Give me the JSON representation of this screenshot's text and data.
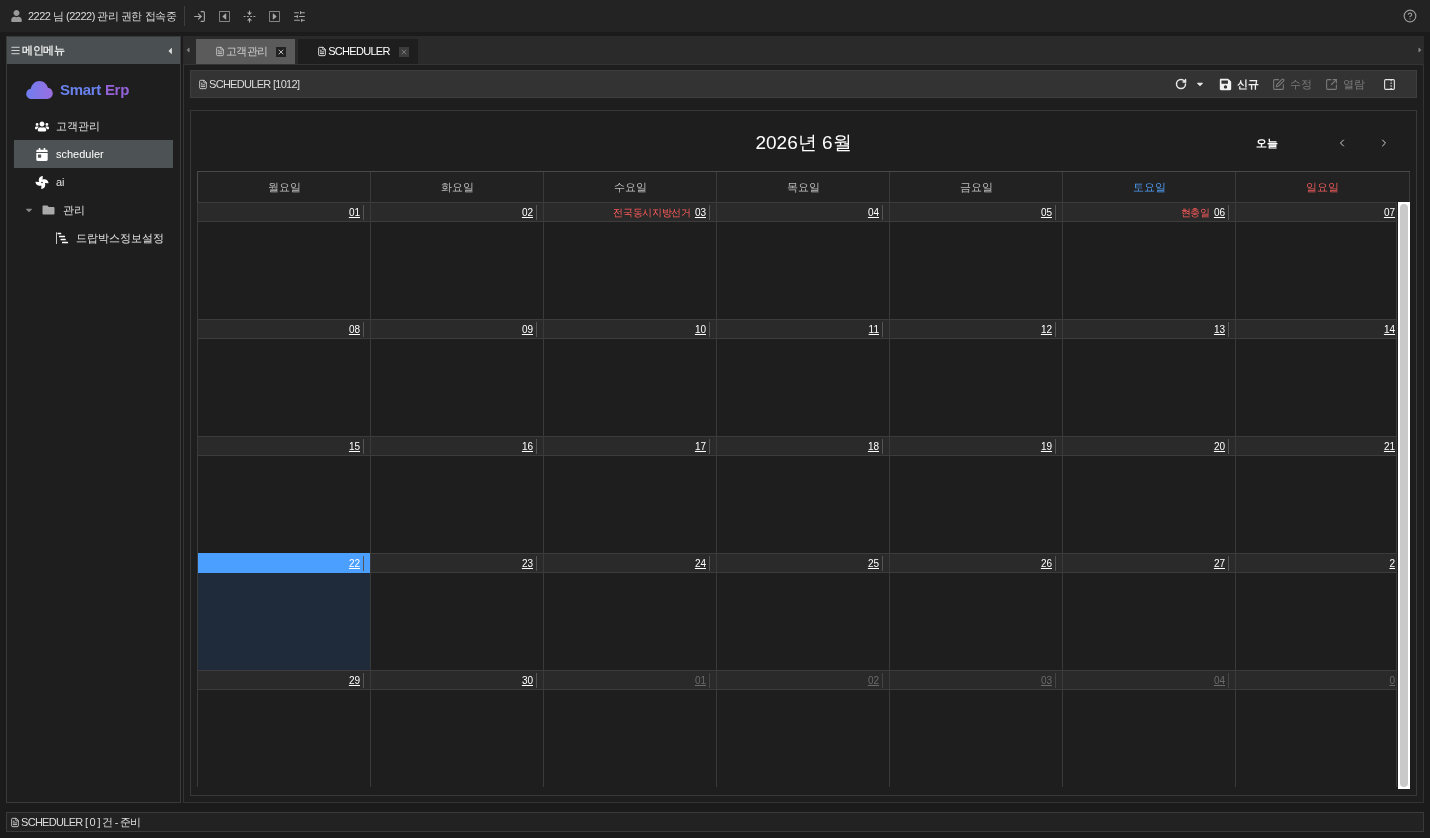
{
  "top_bar": {
    "user_status": "2222 님 (2222) 관리 권한 접속중"
  },
  "sidebar": {
    "title": "메인메뉴",
    "logo": {
      "words": [
        "Smart",
        "Erp"
      ]
    },
    "items": [
      {
        "label": "고객관리",
        "selected": false
      },
      {
        "label": "scheduler",
        "selected": true
      },
      {
        "label": "ai",
        "selected": false
      },
      {
        "label": "관리",
        "selected": false,
        "expanded": true,
        "children": [
          {
            "label": "드랍박스정보설정",
            "selected": false
          }
        ]
      }
    ]
  },
  "tabs": [
    {
      "label": "고객관리",
      "selected": false
    },
    {
      "label": "SCHEDULER",
      "selected": true
    }
  ],
  "toolbar": {
    "title": "SCHEDULER [1012]",
    "buttons": [
      {
        "label": "신규",
        "disabled": false
      },
      {
        "label": "수정",
        "disabled": true
      },
      {
        "label": "열람",
        "disabled": true
      }
    ]
  },
  "calendar": {
    "title": "2026년 6월",
    "today_button": "오늘",
    "weekdays": [
      {
        "label": "월요일",
        "kind": "weekday"
      },
      {
        "label": "화요일",
        "kind": "weekday"
      },
      {
        "label": "수요일",
        "kind": "weekday"
      },
      {
        "label": "목요일",
        "kind": "weekday"
      },
      {
        "label": "금요일",
        "kind": "weekday"
      },
      {
        "label": "토요일",
        "kind": "saturday"
      },
      {
        "label": "일요일",
        "kind": "sunday"
      }
    ],
    "weeks": [
      {
        "days": [
          {
            "date": "01",
            "other_month": false,
            "today": false
          },
          {
            "date": "02",
            "other_month": false,
            "today": false
          },
          {
            "date": "03",
            "other_month": false,
            "today": false,
            "holiday": "전국동시지방선거"
          },
          {
            "date": "04",
            "other_month": false,
            "today": false
          },
          {
            "date": "05",
            "other_month": false,
            "today": false
          },
          {
            "date": "06",
            "other_month": false,
            "today": false,
            "holiday": "현충일"
          },
          {
            "date": "07",
            "other_month": false,
            "today": false
          }
        ]
      },
      {
        "days": [
          {
            "date": "08",
            "other_month": false,
            "today": false
          },
          {
            "date": "09",
            "other_month": false,
            "today": false
          },
          {
            "date": "10",
            "other_month": false,
            "today": false
          },
          {
            "date": "11",
            "other_month": false,
            "today": false
          },
          {
            "date": "12",
            "other_month": false,
            "today": false
          },
          {
            "date": "13",
            "other_month": false,
            "today": false
          },
          {
            "date": "14",
            "other_month": false,
            "today": false
          }
        ]
      },
      {
        "days": [
          {
            "date": "15",
            "other_month": false,
            "today": false
          },
          {
            "date": "16",
            "other_month": false,
            "today": false
          },
          {
            "date": "17",
            "other_month": false,
            "today": false
          },
          {
            "date": "18",
            "other_month": false,
            "today": false
          },
          {
            "date": "19",
            "other_month": false,
            "today": false
          },
          {
            "date": "20",
            "other_month": false,
            "today": false
          },
          {
            "date": "21",
            "other_month": false,
            "today": false
          }
        ]
      },
      {
        "days": [
          {
            "date": "22",
            "other_month": false,
            "today": true
          },
          {
            "date": "23",
            "other_month": false,
            "today": false
          },
          {
            "date": "24",
            "other_month": false,
            "today": false
          },
          {
            "date": "25",
            "other_month": false,
            "today": false
          },
          {
            "date": "26",
            "other_month": false,
            "today": false
          },
          {
            "date": "27",
            "other_month": false,
            "today": false
          },
          {
            "date": "2",
            "other_month": false,
            "today": false
          }
        ]
      },
      {
        "days": [
          {
            "date": "29",
            "other_month": false,
            "today": false
          },
          {
            "date": "30",
            "other_month": false,
            "today": false
          },
          {
            "date": "01",
            "other_month": true,
            "today": false
          },
          {
            "date": "02",
            "other_month": true,
            "today": false
          },
          {
            "date": "03",
            "other_month": true,
            "today": false
          },
          {
            "date": "04",
            "other_month": true,
            "today": false
          },
          {
            "date": "0",
            "other_month": true,
            "today": false
          }
        ]
      }
    ]
  },
  "status_bar": {
    "text": "SCHEDULER [ 0 ] 건 - 준비"
  }
}
